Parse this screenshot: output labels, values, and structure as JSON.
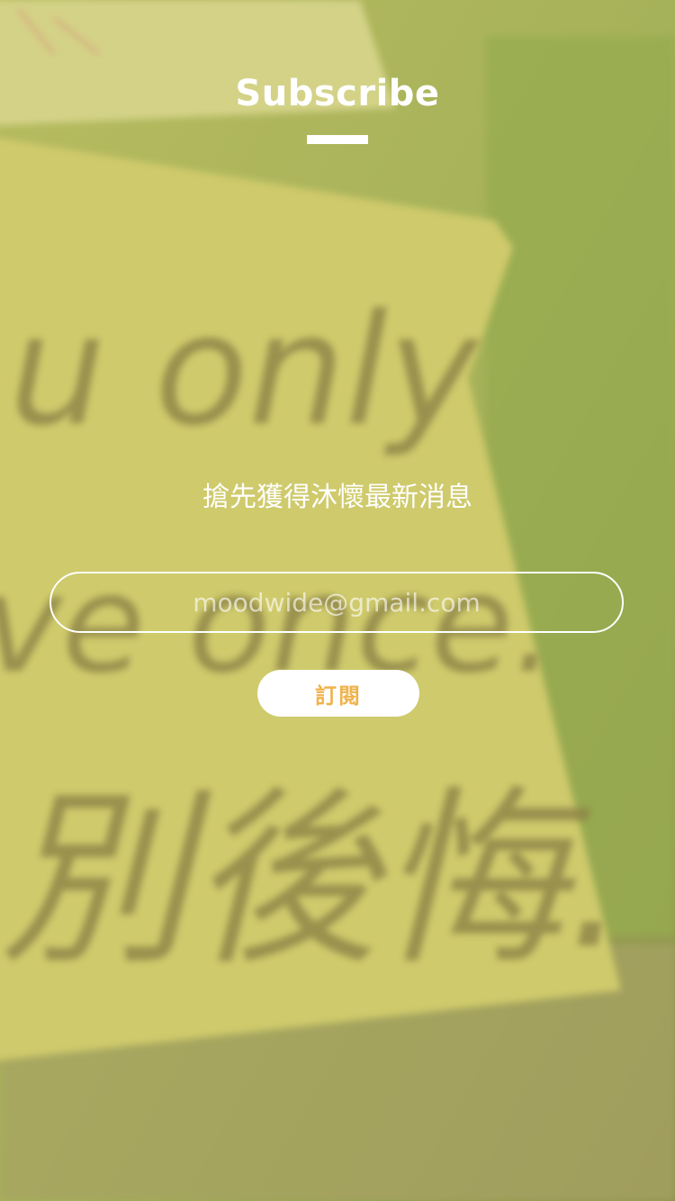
{
  "header": {
    "title": "Subscribe"
  },
  "subtitle": "搶先獲得沐懷最新消息",
  "form": {
    "email_placeholder": "moodwide@gmail.com",
    "submit_label": "訂閱"
  },
  "background": {
    "note_line_1": "u only",
    "note_line_2": "ve once.",
    "note_line_3": "別後悔."
  },
  "colors": {
    "accent": "#f0b24a",
    "text": "#ffffff"
  }
}
